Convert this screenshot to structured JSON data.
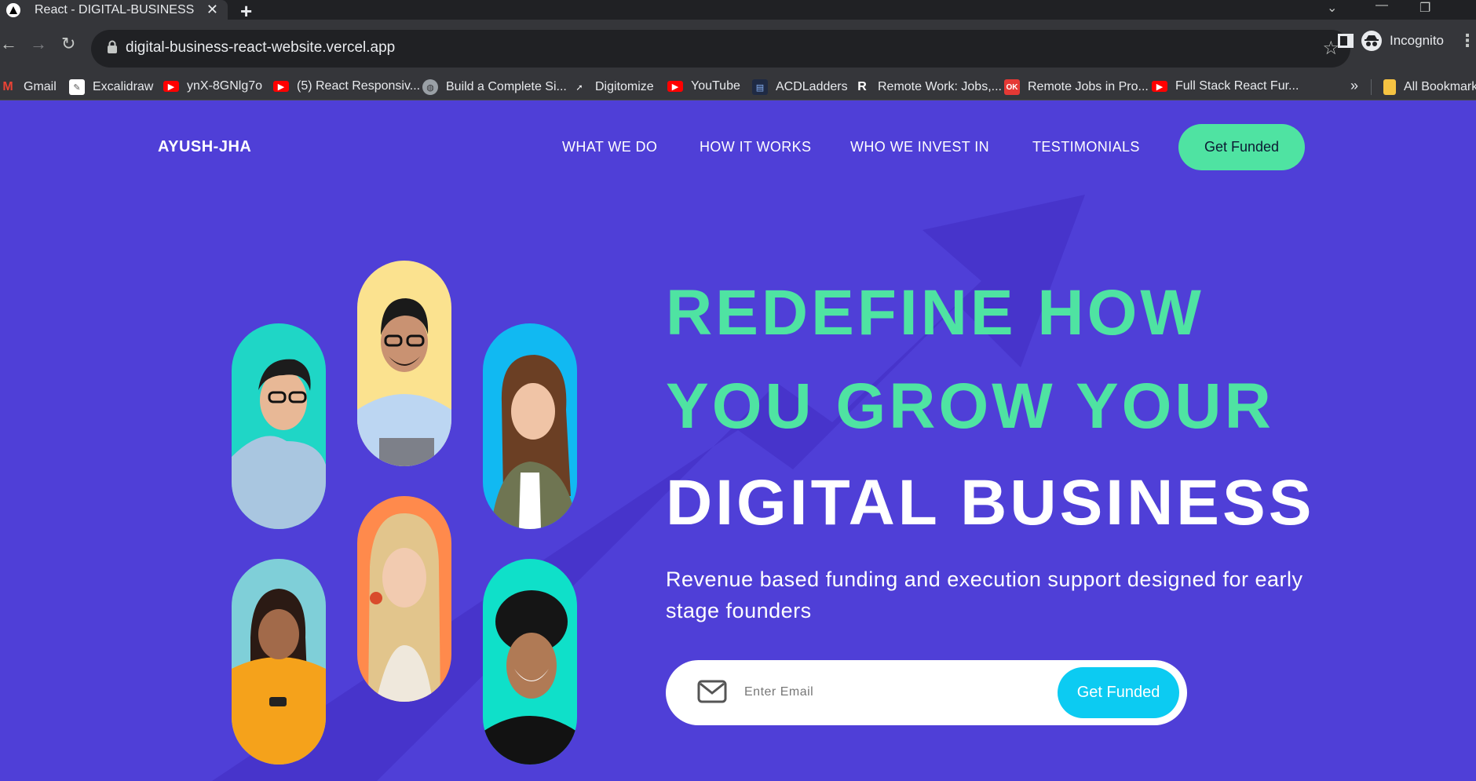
{
  "browser": {
    "tab_title": "React - DIGITAL-BUSINESS",
    "url": "digital-business-react-website.vercel.app",
    "profile_label": "Incognito",
    "bookmarks": [
      {
        "label": "Gmail",
        "icon": "gmail-icon"
      },
      {
        "label": "Excalidraw",
        "icon": "excalidraw-icon"
      },
      {
        "label": "ynX-8GNlg7o",
        "icon": "youtube-icon"
      },
      {
        "label": "(5) React Responsiv...",
        "icon": "youtube-icon"
      },
      {
        "label": "Build a Complete Si...",
        "icon": "globe-icon"
      },
      {
        "label": "Digitomize",
        "icon": "digitomize-icon"
      },
      {
        "label": "YouTube",
        "icon": "youtube-icon"
      },
      {
        "label": "ACDLadders",
        "icon": "acdladders-icon"
      },
      {
        "label": "Remote Work: Jobs,...",
        "icon": "remote-r-icon"
      },
      {
        "label": "Remote Jobs in Pro...",
        "icon": "ok-icon"
      },
      {
        "label": "Full Stack React Fur...",
        "icon": "youtube-icon"
      }
    ],
    "all_bookmarks_label": "All Bookmarks"
  },
  "site": {
    "logo": "AYUSH-JHA",
    "nav": {
      "links": [
        "WHAT WE DO",
        "HOW IT WORKS",
        "WHO WE INVEST IN",
        "TESTIMONIALS"
      ],
      "cta": "Get Funded"
    },
    "hero": {
      "line1": "REDEFINE HOW",
      "line2": "YOU GROW YOUR",
      "line3": "DIGITAL BUSINESS",
      "subtitle": "Revenue based funding and execution support designed for early stage founders",
      "email_placeholder": "Enter Email",
      "form_cta": "Get Funded"
    }
  },
  "colors": {
    "page_bg": "#4f3fd7",
    "accent_green": "#4fe3a2",
    "accent_cyan": "#0ccbf2"
  }
}
